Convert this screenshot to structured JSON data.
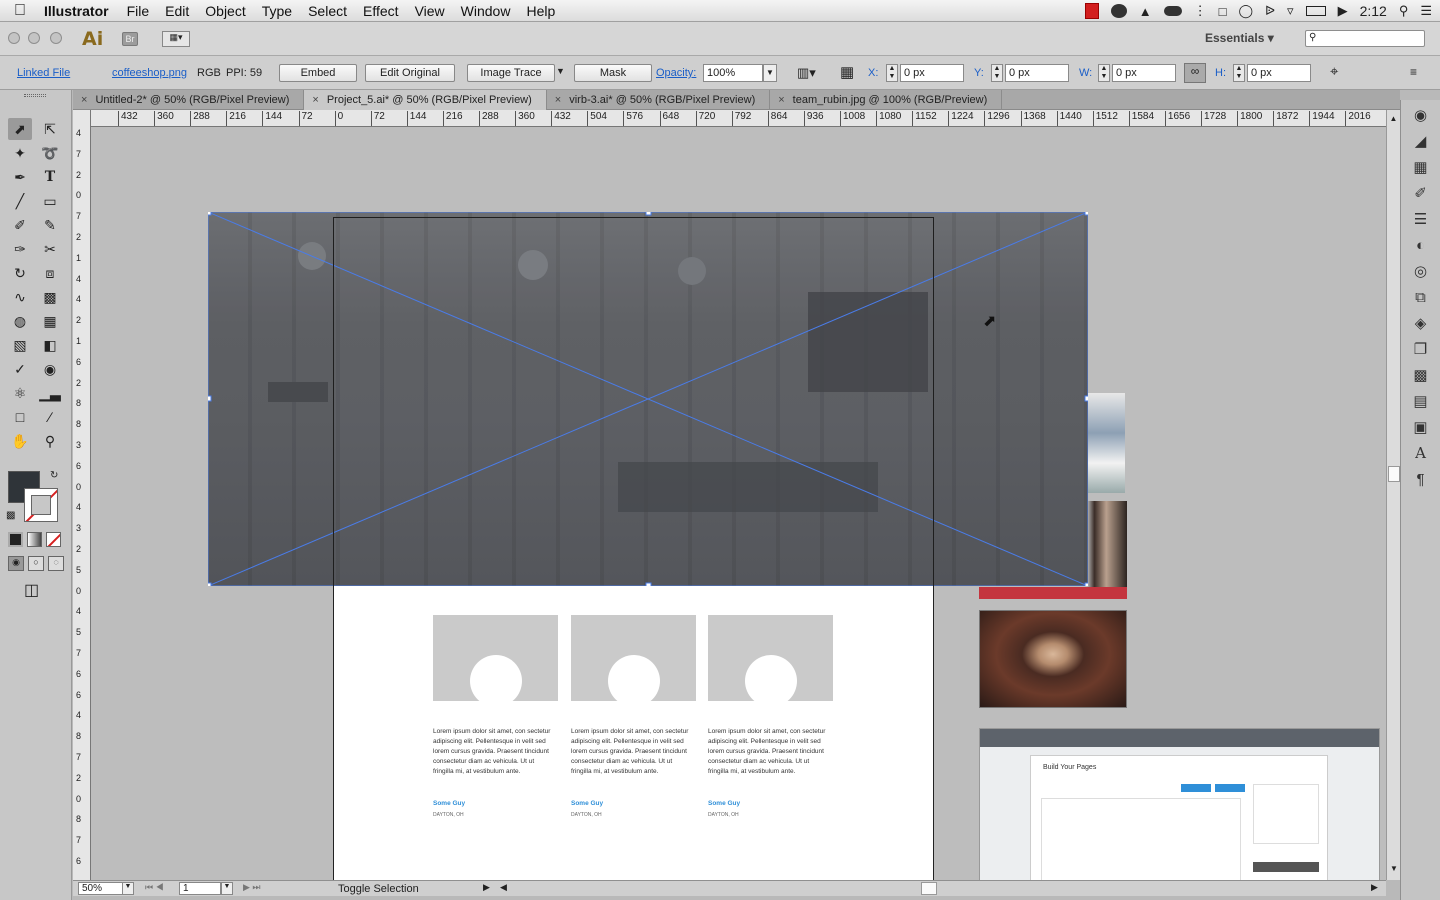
{
  "menubar": {
    "app_name": "Illustrator",
    "items": [
      "File",
      "Edit",
      "Object",
      "Type",
      "Select",
      "Effect",
      "View",
      "Window",
      "Help"
    ],
    "clock": "2:12"
  },
  "appbar": {
    "logo": "Ai",
    "bridge": "Br",
    "workspace": "Essentials",
    "search_placeholder": ""
  },
  "control": {
    "linked_file": "Linked File",
    "file_name": "coffeeshop.png",
    "color_mode": "RGB",
    "ppi": "PPI: 59",
    "embed": "Embed",
    "edit_original": "Edit Original",
    "image_trace": "Image Trace",
    "mask": "Mask",
    "opacity_label": "Opacity:",
    "opacity_value": "100%",
    "x_label": "X:",
    "x_value": "0 px",
    "y_label": "Y:",
    "y_value": "0 px",
    "w_label": "W:",
    "w_value": "0 px",
    "h_label": "H:",
    "h_value": "0 px"
  },
  "tabs": [
    {
      "label": "Untitled-2* @ 50% (RGB/Pixel Preview)",
      "active": false
    },
    {
      "label": "Project_5.ai* @ 50% (RGB/Pixel Preview)",
      "active": true
    },
    {
      "label": "virb-3.ai* @ 50% (RGB/Pixel Preview)",
      "active": false
    },
    {
      "label": "team_rubin.jpg @ 100% (RGB/Preview)",
      "active": false
    }
  ],
  "ruler": {
    "h_ticks": [
      "432",
      "360",
      "288",
      "216",
      "144",
      "72",
      "0",
      "72",
      "144",
      "216",
      "288",
      "360",
      "432",
      "504",
      "576",
      "648",
      "720",
      "792",
      "864",
      "936",
      "1008",
      "1080",
      "1152",
      "1224",
      "1296",
      "1368",
      "1440",
      "1512",
      "1584",
      "1656",
      "1728",
      "1800",
      "1872",
      "1944",
      "2016"
    ],
    "v_ticks": [
      "4",
      "7",
      "2",
      "0",
      "7",
      "2",
      "1",
      "4",
      "4",
      "2",
      "1",
      "6",
      "2",
      "8",
      "8",
      "3",
      "6",
      "0",
      "4",
      "3",
      "2",
      "5",
      "0",
      "4",
      "5",
      "7",
      "6",
      "6",
      "4",
      "8",
      "7",
      "2",
      "0",
      "8",
      "7",
      "6"
    ]
  },
  "artboard": {
    "cards": [
      {
        "text": "Lorem ipsum dolor sit amet, con sectetur adipiscing elit. Pellentesque in velit sed lorem cursus gravida. Praesent tincidunt consectetur diam ac vehicula. Ut ut fringilla mi, at vestibulum ante.",
        "name": "Some Guy",
        "location": "DAYTON, OH"
      },
      {
        "text": "Lorem ipsum dolor sit amet, con sectetur adipiscing elit. Pellentesque in velit sed lorem cursus gravida. Praesent tincidunt consectetur diam ac vehicula. Ut ut fringilla mi, at vestibulum ante.",
        "name": "Some Guy",
        "location": "DAYTON, OH"
      },
      {
        "text": "Lorem ipsum dolor sit amet, con sectetur adipiscing elit. Pellentesque in velit sed lorem cursus gravida. Praesent tincidunt consectetur diam ac vehicula. Ut ut fringilla mi, at vestibulum ante.",
        "name": "Some Guy",
        "location": "DAYTON, OH"
      }
    ]
  },
  "mockup": {
    "heading": "Build Your Pages"
  },
  "status": {
    "zoom": "50%",
    "page": "1",
    "message": "Toggle Selection"
  },
  "colors": {
    "selection": "#4a7ce8",
    "fill": "#2f3439",
    "accent": "#2f8fd8"
  }
}
